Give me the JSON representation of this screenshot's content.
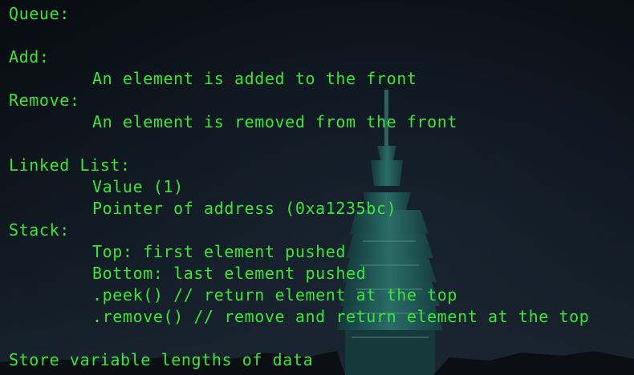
{
  "terminal": {
    "lines": [
      {
        "text": "Queue:",
        "indent": false
      },
      {
        "text": "",
        "indent": false
      },
      {
        "text": "Add:",
        "indent": false
      },
      {
        "text": "An element is added to the front",
        "indent": true
      },
      {
        "text": "Remove:",
        "indent": false
      },
      {
        "text": "An element is removed from the front",
        "indent": true
      },
      {
        "text": "",
        "indent": false
      },
      {
        "text": "Linked List:",
        "indent": false
      },
      {
        "text": "Value (1)",
        "indent": true
      },
      {
        "text": "Pointer of address (0xa1235bc)",
        "indent": true
      },
      {
        "text": "Stack:",
        "indent": false
      },
      {
        "text": "Top: first element pushed",
        "indent": true
      },
      {
        "text": "Bottom: last element pushed",
        "indent": true
      },
      {
        "text": ".peek() // return element at the top",
        "indent": true
      },
      {
        "text": ".remove() // remove and return element at the top",
        "indent": true
      },
      {
        "text": "",
        "indent": false
      },
      {
        "text": "Store variable lengths of data",
        "indent": false
      }
    ]
  },
  "colors": {
    "text": "#39e639",
    "background": "#0d141c",
    "tower": "#1f5a55"
  }
}
